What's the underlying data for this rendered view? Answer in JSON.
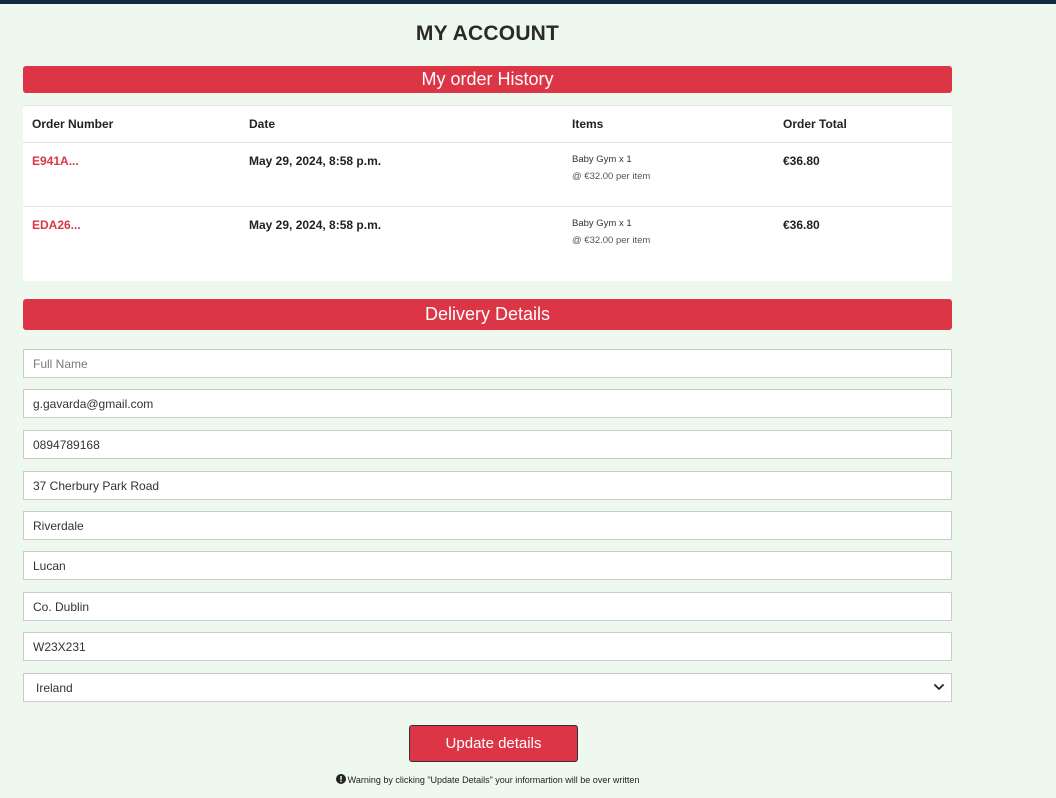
{
  "page": {
    "title": "MY ACCOUNT"
  },
  "order_history": {
    "heading": "My order History",
    "columns": [
      "Order Number",
      "Date",
      "Items",
      "Order Total"
    ],
    "orders": [
      {
        "number": "E941A...",
        "date": "May 29, 2024, 8:58 p.m.",
        "item": "Baby Gym x 1",
        "price": "@ €32.00 per item",
        "total": "€36.80"
      },
      {
        "number": "EDA26...",
        "date": "May 29, 2024, 8:58 p.m.",
        "item": "Baby Gym x 1",
        "price": "@ €32.00 per item",
        "total": "€36.80"
      }
    ]
  },
  "delivery": {
    "heading": "Delivery Details",
    "full_name_placeholder": "Full Name",
    "email": "g.gavarda@gmail.com",
    "phone": "0894789168",
    "street1": "37 Cherbury Park Road",
    "street2": "Riverdale",
    "town": "Lucan",
    "county": "Co. Dublin",
    "postcode": "W23X231",
    "country": "Ireland",
    "update_button": "Update details",
    "warning": "Warning by clicking \"Update Details\" your informartion will be over written"
  },
  "colors": {
    "accent": "#dc3545",
    "background": "#eff8ee",
    "top_bar": "#0f2b3f"
  },
  "icons": {
    "warning": "exclamation-circle-icon",
    "select": "chevron-down-icon"
  }
}
